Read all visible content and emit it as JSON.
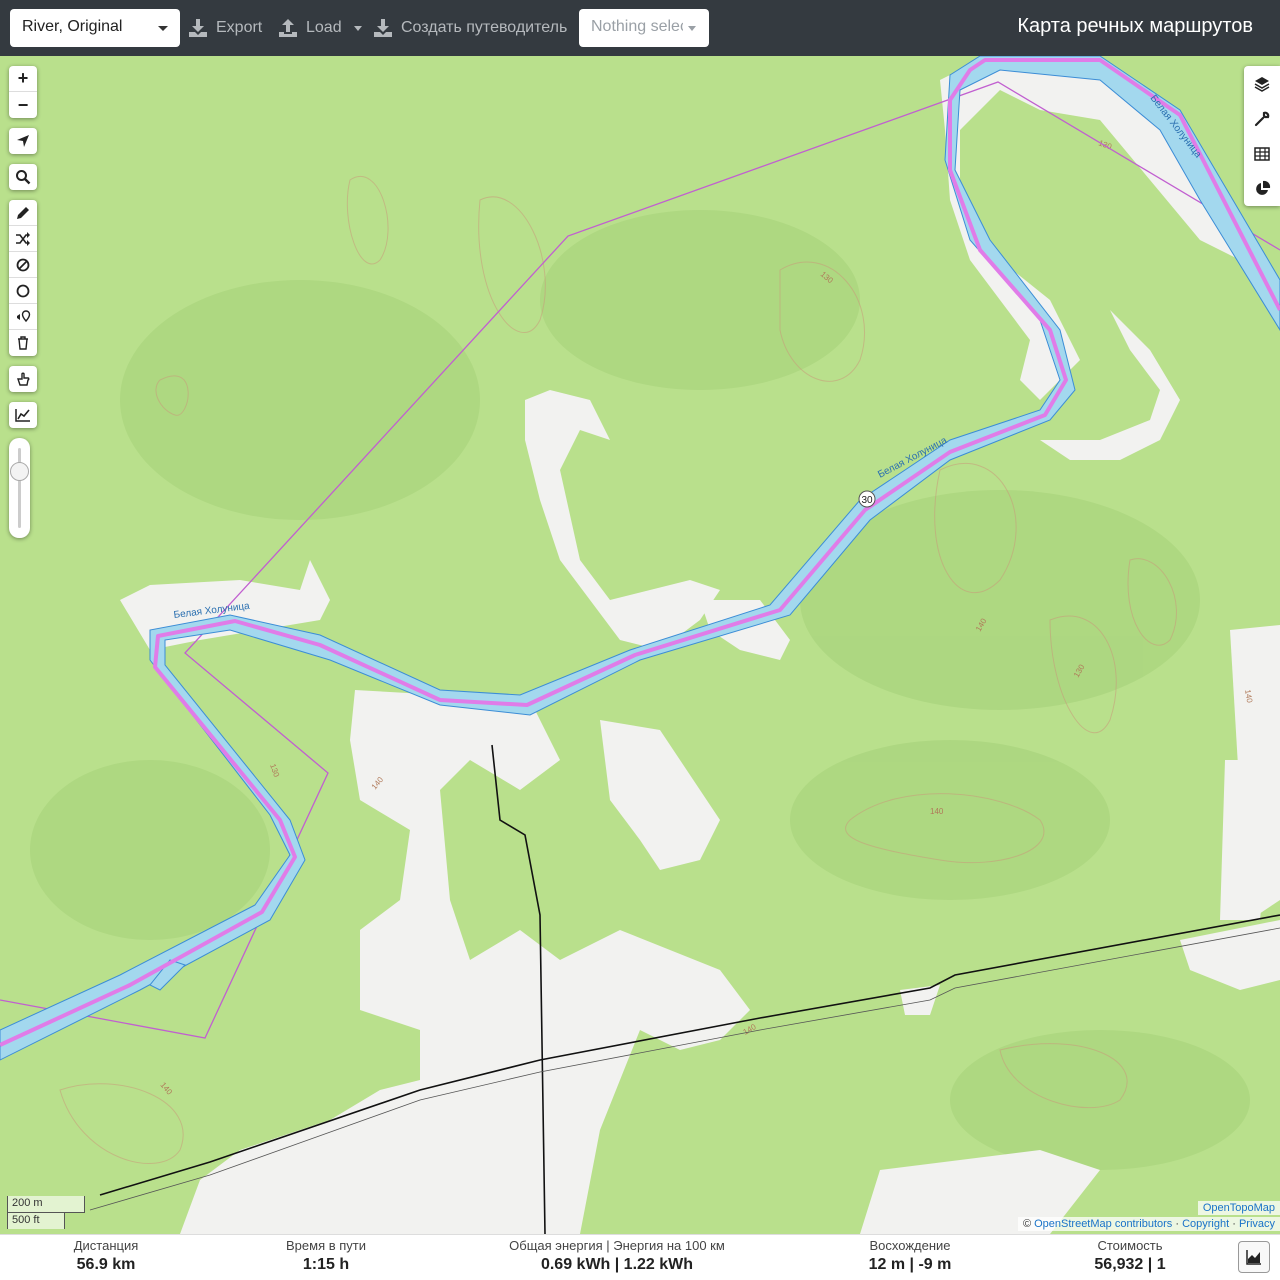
{
  "topbar": {
    "profile": "River, Original",
    "export_label": "Export",
    "load_label": "Load",
    "guide_label": "Создать путеводитель",
    "nothing_selected": "Nothing selected",
    "title": "Карта речных маршрутов"
  },
  "toolbar": {
    "zoom_in": "+",
    "zoom_out": "−"
  },
  "map": {
    "river_name_1": "Белая Холуница",
    "river_name_2": "Белая Холуница",
    "river_name_3": "Белая Холуница",
    "marker": "30",
    "contours": [
      "130",
      "130",
      "140",
      "140",
      "130",
      "140",
      "130",
      "140",
      "140",
      "140"
    ]
  },
  "scale": {
    "metric": "200 m",
    "imperial": "500 ft"
  },
  "attribution": {
    "topo": "OpenTopoMap",
    "osm_prefix": "© ",
    "osm": "OpenStreetMap contributors",
    "sep1": " · ",
    "copyright": "Copyright",
    "sep2": " · ",
    "privacy": "Privacy"
  },
  "stats": {
    "distance_label": "Дистанция",
    "distance_value": "56.9 km",
    "time_label": "Время в пути",
    "time_value": "1:15 h",
    "energy_label": "Общая энергия | Энергия на 100 км",
    "energy_value": "0.69 kWh | 1.22 kWh",
    "ascent_label": "Восхождение",
    "ascent_value": "12 m | -9 m",
    "cost_label": "Стоимость",
    "cost_value": "56,932 | 1"
  },
  "colors": {
    "topbar": "#343a40",
    "forest": "#b8e08a",
    "river": "#9fd6ef",
    "route": "#e07ce8",
    "boundary": "#c15fd0"
  }
}
